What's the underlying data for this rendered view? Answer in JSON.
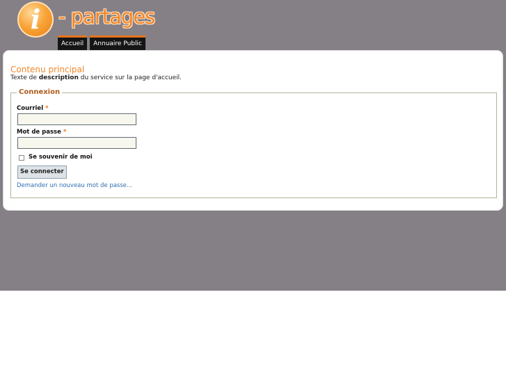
{
  "header": {
    "logo_letter": "i",
    "logo_text": "- partages",
    "nav": [
      {
        "label": "Accueil"
      },
      {
        "label": "Annuaire Public"
      }
    ]
  },
  "content": {
    "title": "Contenu principal",
    "description_prefix": "Texte de ",
    "description_bold": "description",
    "description_suffix": " du service sur la page d'accueil."
  },
  "login": {
    "legend": "Connexion",
    "email_label": "Courriel",
    "password_label": "Mot de passe",
    "required_mark": "*",
    "email_value": "",
    "password_value": "",
    "remember_label": "Se souvenir de moi",
    "submit_label": "Se connecter",
    "forgot_link": "Demander un nouveau mot de passe..."
  },
  "colors": {
    "background": "#857f86",
    "accent": "#f0862a",
    "link": "#2f6fb1"
  }
}
